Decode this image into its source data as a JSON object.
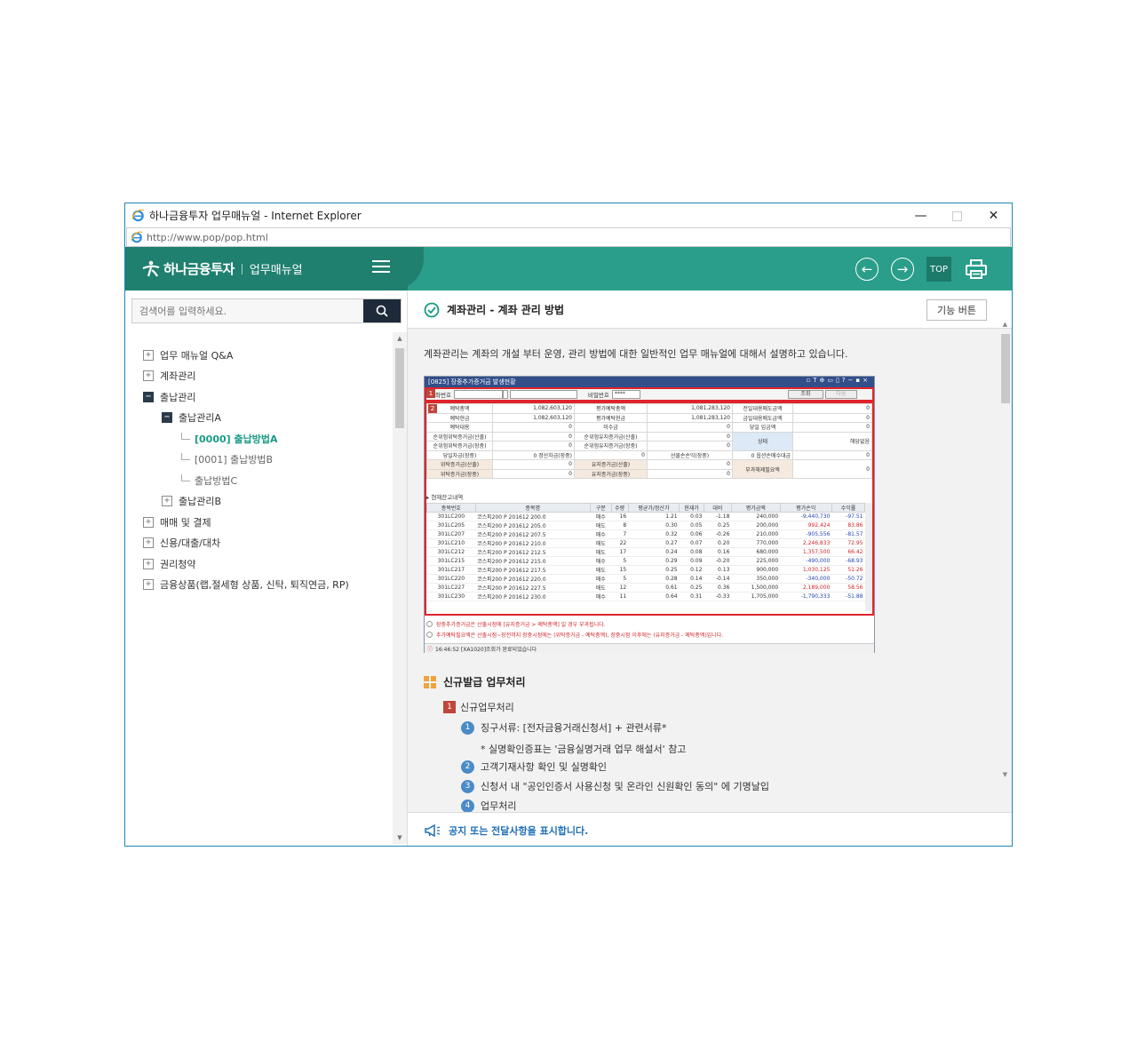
{
  "window": {
    "title": "하나금융투자 업무매뉴얼 - Internet Explorer",
    "url": "http://www.pop/pop.html",
    "minimize": "—",
    "maximize": "□",
    "close": "✕"
  },
  "header": {
    "brand_name": "하나금융투자",
    "brand_sub": "업무매뉴얼",
    "top_label": "TOP"
  },
  "sidebar": {
    "search_placeholder": "검색어를 입력하세요.",
    "tree": [
      {
        "label": "업무 매뉴얼 Q&A",
        "toggle": "+"
      },
      {
        "label": "계좌관리",
        "toggle": "+"
      },
      {
        "label": "출납관리",
        "toggle": "−"
      },
      {
        "label": "출납관리A",
        "toggle": "−"
      },
      {
        "label": "[0000] 출납방법A"
      },
      {
        "label": "[0001] 출납방법B"
      },
      {
        "label": "출납방법C"
      },
      {
        "label": "출납관리B",
        "toggle": "+"
      },
      {
        "label": "매매 및 결제",
        "toggle": "+"
      },
      {
        "label": "신용/대출/대차",
        "toggle": "+"
      },
      {
        "label": "권리청약",
        "toggle": "+"
      },
      {
        "label": "금융상품(랩,절세형 상품, 신탁, 퇴직연금, RP)",
        "toggle": "+"
      }
    ]
  },
  "content": {
    "title": "계좌관리 - 계좌 관리 방법",
    "func_button": "기능 버튼",
    "intro": "계좌관리는 계좌의 개설 부터 운영, 관리 방법에 대한 일반적인 업무 매뉴얼에 대해서 설명하고 있습니다.",
    "section_title": "신규발급 업무처리",
    "sub_num": "1",
    "sub_title": "신규업무처리",
    "steps": [
      {
        "num": "1",
        "text": "징구서류: [전자금융거래신청서] + 관련서류*"
      },
      {
        "num": "2",
        "text": "고객기재사항 확인 및 실명확인"
      },
      {
        "num": "3",
        "text": "신청서 내 \"공인인증서 사용신청 및 온라인 신원확인 동의\" 에 기명날입"
      },
      {
        "num": "4",
        "text": "업무처리"
      }
    ],
    "note": "* 실명확인증표는 '금융실명거래 업무 해설서' 참고",
    "notice": "공지 또는 전달사항을 표시합니다."
  },
  "hts": {
    "title": "[0825] 장중추가증거금 발생현황",
    "badge1": "1",
    "badge2": "2",
    "acct_label": "계좌번호",
    "pw_label": "비밀번호",
    "pw_value": "****",
    "query_btn": "조회",
    "next_btn": "다음",
    "rows": [
      [
        "예탁총액",
        "1,082,603,120",
        "평가예탁총액",
        "1,081,283,120",
        "전일대용매도금액",
        "0"
      ],
      [
        "예탁현금",
        "1,082,603,120",
        "평가예탁현금",
        "1,081,283,120",
        "금일대용매도금액",
        "0"
      ],
      [
        "예탁대용",
        "0",
        "미수금",
        "0",
        "당일 입금액",
        "0"
      ]
    ],
    "rows2": [
      [
        "순위험위탁증거금(산출)",
        "0",
        "순위험유지증거금(산출)",
        "0"
      ],
      [
        "순위험위탁증거금(장중)",
        "0",
        "순위험유지증거금(장중)",
        "0"
      ]
    ],
    "state_label": "상태",
    "state_value": "해당없음",
    "row3": [
      "당일차금(장중)",
      "0",
      "정산차금(장중)",
      "0",
      "선물손손익(장중)",
      "0",
      "옵션손매수대금",
      "0"
    ],
    "rows4": [
      [
        "위탁증거금(산출)",
        "0",
        "유지증거금(산출)",
        "0"
      ],
      [
        "위탁증거금(장중)",
        "0",
        "유지증거금(장중)",
        "0"
      ]
    ],
    "extra_label": "부과해제필요액",
    "extra_value": "0",
    "sub_label": "▸ 현재잔고내역",
    "pos_headers": [
      "종목번호",
      "종목명",
      "구분",
      "수량",
      "평균가/정산가",
      "현재가",
      "대비",
      "평가금액",
      "평가손익",
      "수익률"
    ],
    "pos_rows": [
      [
        "301LC200",
        "코스피200 P 201612 200.0",
        "매수",
        "16",
        "1.21",
        "0.03",
        "-1.18",
        "240,000",
        "-9,440,730",
        "-97.51"
      ],
      [
        "301LC205",
        "코스피200 P 201612 205.0",
        "매도",
        "8",
        "0.30",
        "0.05",
        "0.25",
        "200,000",
        "992,424",
        "83.86"
      ],
      [
        "301LC207",
        "코스피200 P 201612 207.5",
        "매수",
        "7",
        "0.32",
        "0.06",
        "-0.26",
        "210,000",
        "-905,556",
        "-81.57"
      ],
      [
        "301LC210",
        "코스피200 P 201612 210.0",
        "매도",
        "22",
        "0.27",
        "0.07",
        "0.20",
        "770,000",
        "2,246,833",
        "72.95"
      ],
      [
        "301LC212",
        "코스피200 P 201612 212.5",
        "매도",
        "17",
        "0.24",
        "0.08",
        "0.16",
        "680,000",
        "1,357,500",
        "66.42"
      ],
      [
        "301LC215",
        "코스피200 P 201612 215.0",
        "매수",
        "5",
        "0.29",
        "0.09",
        "-0.20",
        "225,000",
        "-490,000",
        "-68.93"
      ],
      [
        "301LC217",
        "코스피200 P 201612 217.5",
        "매도",
        "15",
        "0.25",
        "0.12",
        "0.13",
        "900,000",
        "1,030,125",
        "51.26"
      ],
      [
        "301LC220",
        "코스피200 P 201612 220.0",
        "매수",
        "5",
        "0.28",
        "0.14",
        "-0.14",
        "350,000",
        "-340,000",
        "-50.72"
      ],
      [
        "301LC227",
        "코스피200 P 201612 227.5",
        "매도",
        "12",
        "0.61",
        "0.25",
        "0.36",
        "1,500,000",
        "2,189,000",
        "58.56"
      ],
      [
        "301LC230",
        "코스피200 P 201612 230.0",
        "매수",
        "11",
        "0.64",
        "0.31",
        "-0.33",
        "1,705,000",
        "-1,790,333",
        "-51.88"
      ]
    ],
    "foot1": "장중추가증거금은 산출시점에 [유지증거금 > 예탁총액] 일 경우 부과됩니다.",
    "foot2": "추가예탁필요액은 산출시점~장전까지 장중시점에는 (위탁증거금 - 예탁총액), 장중시점 이후에는 (유지증거금 - 예탁총액)입니다.",
    "status": "16:46:52    [XA1020]조회가 완료되었습니다"
  },
  "colors": {
    "header": "#2a9e8a",
    "brand": "#20806f",
    "active": "#1a9b84",
    "red": "#e0242a"
  },
  "icons": [
    "ie-icon",
    "menu-icon",
    "back-icon",
    "forward-icon",
    "print-icon",
    "search-icon",
    "check-circle-icon",
    "megaphone-icon"
  ]
}
